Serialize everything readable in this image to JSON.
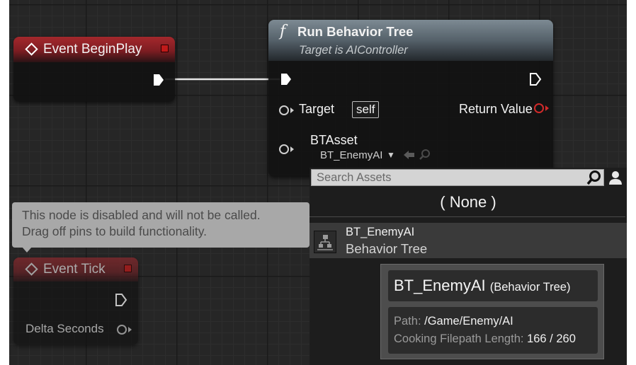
{
  "nodes": {
    "begin_play": {
      "title": "Event BeginPlay"
    },
    "run_behavior_tree": {
      "function_glyph": "f",
      "title": "Run Behavior Tree",
      "subtitle": "Target is AIController",
      "target_label": "Target",
      "target_default": "self",
      "return_label": "Return Value",
      "btasset_label": "BTAsset",
      "btasset_value": "BT_EnemyAI"
    },
    "event_tick": {
      "title": "Event Tick",
      "delta_label": "Delta Seconds"
    }
  },
  "comment": {
    "line1": "This node is disabled and will not be called.",
    "line2": "Drag off pins to build functionality."
  },
  "asset_picker": {
    "search_placeholder": "Search Assets",
    "none_option": "( None )",
    "items": [
      {
        "name": "BT_EnemyAI",
        "type": "Behavior Tree"
      }
    ]
  },
  "tooltip": {
    "title": "BT_EnemyAI",
    "title_type": "(Behavior Tree)",
    "path_label": "Path:",
    "path_value": "/Game/Enemy/AI",
    "cooking_label": "Cooking Filepath Length:",
    "cooking_value": "166 / 260"
  },
  "colors": {
    "event_header": "#a4282c",
    "function_header": "#7d8a93",
    "return_pin": "#d02a2a",
    "disabled_comment": "#a8a8a8"
  },
  "icons": [
    "event-diamond-icon",
    "function-icon",
    "exec-pin-icon",
    "data-pin-icon",
    "search-icon",
    "user-icon",
    "behavior-tree-icon",
    "browse-arrow-icon",
    "magnifier-icon",
    "dropdown-arrow-icon"
  ]
}
